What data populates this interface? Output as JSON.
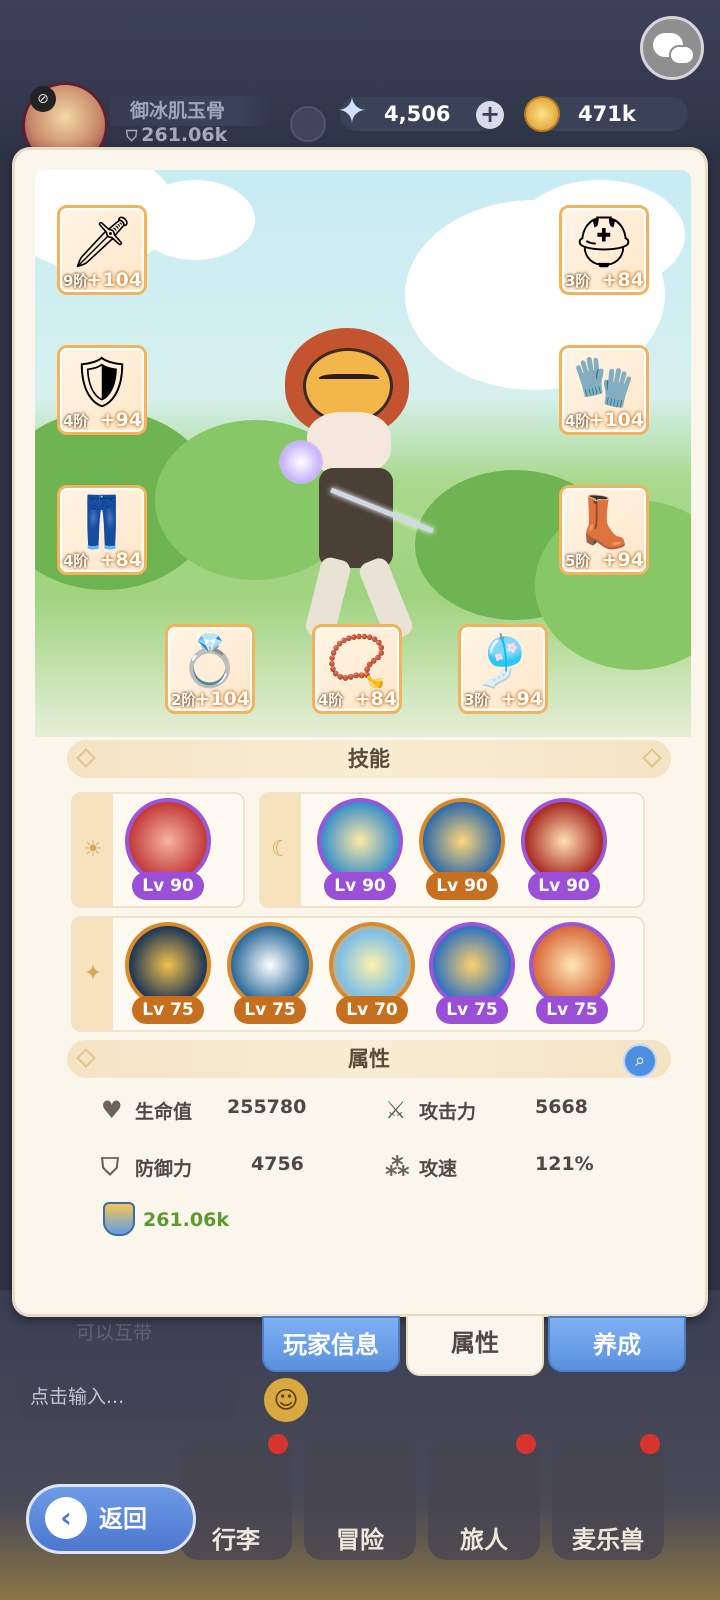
{
  "hud": {
    "player_name": "御冰肌玉骨",
    "player_power": "261.06k",
    "gems": "4,506",
    "gold": "471k"
  },
  "equipment": [
    {
      "slot": "weapon",
      "icon": "sword-icon",
      "tier": "9阶",
      "bonus": "+104"
    },
    {
      "slot": "helmet",
      "icon": "helmet-icon",
      "tier": "3阶",
      "bonus": "+84"
    },
    {
      "slot": "armor",
      "icon": "armor-icon",
      "tier": "4阶",
      "bonus": "+94"
    },
    {
      "slot": "gloves",
      "icon": "gloves-icon",
      "tier": "4阶",
      "bonus": "+104"
    },
    {
      "slot": "pants",
      "icon": "pants-icon",
      "tier": "4阶",
      "bonus": "+84"
    },
    {
      "slot": "boots",
      "icon": "boots-icon",
      "tier": "5阶",
      "bonus": "+94"
    },
    {
      "slot": "ring",
      "icon": "ring-icon",
      "tier": "2阶",
      "bonus": "+104"
    },
    {
      "slot": "necklace",
      "icon": "necklace-icon",
      "tier": "4阶",
      "bonus": "+84"
    },
    {
      "slot": "charm",
      "icon": "charm-icon",
      "tier": "3阶",
      "bonus": "+94"
    }
  ],
  "skills_section": {
    "title": "技能",
    "row1_left": [
      {
        "icon": "burst-skill-icon",
        "level": "Lv 90",
        "color": "purple"
      }
    ],
    "row1_right": [
      {
        "icon": "angel-skill-icon",
        "level": "Lv 90",
        "color": "purple"
      },
      {
        "icon": "hero-skill-icon",
        "level": "Lv 90",
        "color": "orange"
      },
      {
        "icon": "vortex-skill-icon",
        "level": "Lv 90",
        "color": "purple"
      }
    ],
    "row2": [
      {
        "icon": "crescent-skill-icon",
        "level": "Lv 75",
        "color": "orange"
      },
      {
        "icon": "slash-skill-icon",
        "level": "Lv 75",
        "color": "orange"
      },
      {
        "icon": "eye-skill-icon",
        "level": "Lv 70",
        "color": "orange"
      },
      {
        "icon": "orbit-skill-icon",
        "level": "Lv 75",
        "color": "purple"
      },
      {
        "icon": "strike-skill-icon",
        "level": "Lv 75",
        "color": "purple"
      }
    ]
  },
  "attributes_section": {
    "title": "属性",
    "hp_label": "生命值",
    "hp_value": "255780",
    "atk_label": "攻击力",
    "atk_value": "5668",
    "def_label": "防御力",
    "def_value": "4756",
    "spd_label": "攻速",
    "spd_value": "121%",
    "power_value": "261.06k"
  },
  "tabs": {
    "player_info": "玩家信息",
    "attributes": "属性",
    "develop": "养成"
  },
  "background": {
    "chat_snippet": "可以互带",
    "input_placeholder": "点击输入..."
  },
  "nav": {
    "back": "返回",
    "bag": "行李",
    "adventure": "冒险",
    "traveler": "旅人",
    "pet": "麦乐兽"
  },
  "colors": {
    "accent_blue": "#5a90de",
    "panel_bg": "#fbf6ec",
    "purple_level": "#9b4fd6",
    "orange_level": "#c66f1e",
    "power_green": "#5c9a2c"
  }
}
